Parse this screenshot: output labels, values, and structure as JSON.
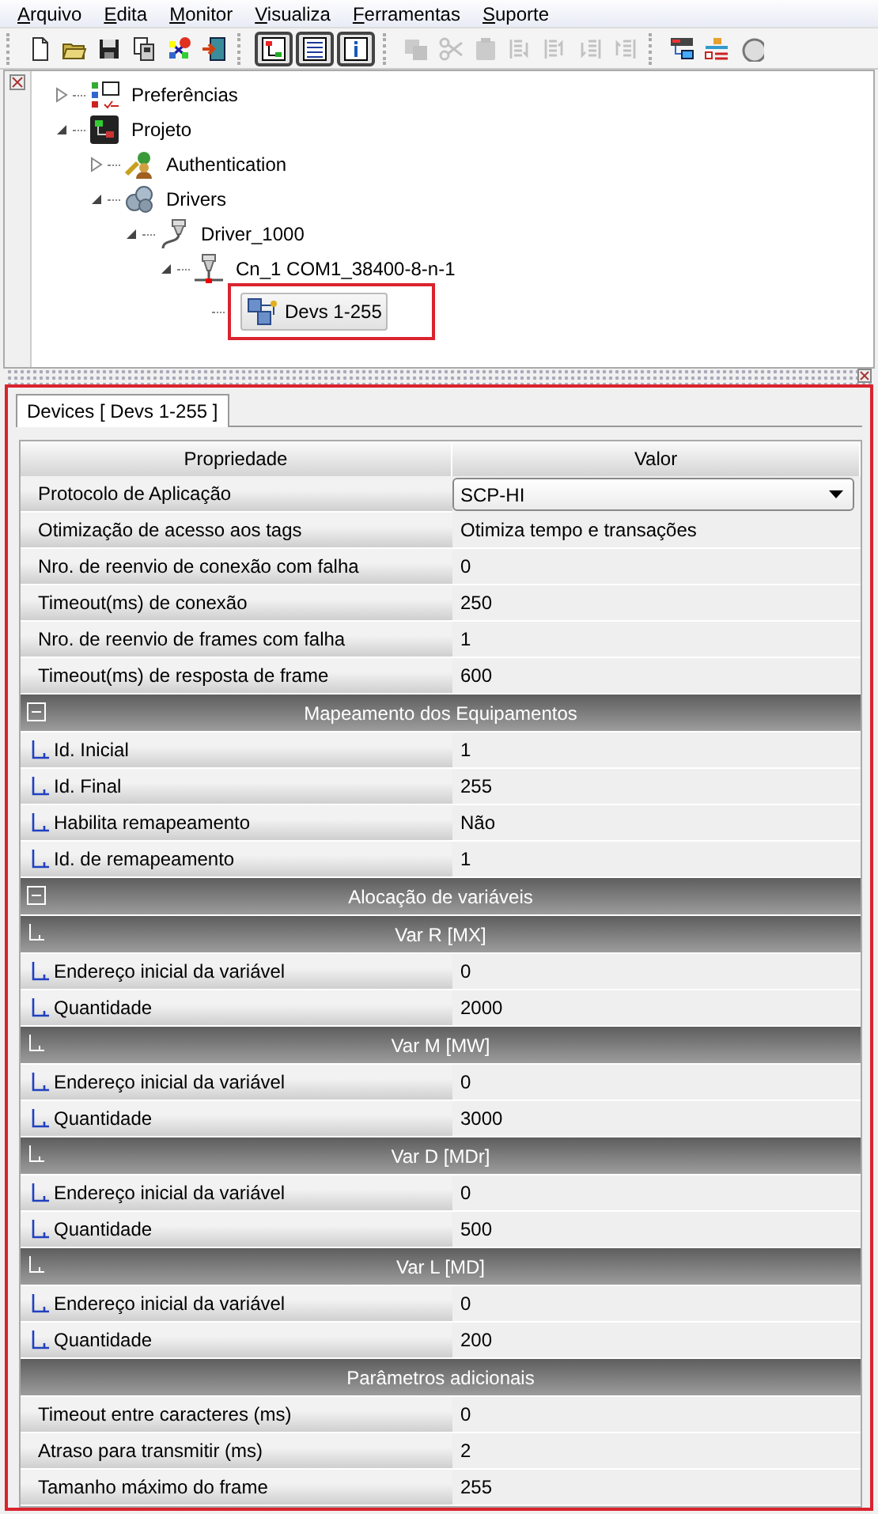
{
  "menu": [
    "Arquivo",
    "Edita",
    "Monitor",
    "Visualiza",
    "Ferramentas",
    "Suporte"
  ],
  "toolbar": [
    [
      {
        "disabled": false
      },
      {
        "disabled": false
      },
      {
        "disabled": false
      },
      {
        "disabled": false
      },
      {
        "disabled": false
      },
      {
        "disabled": false
      }
    ],
    [
      {
        "pressed": true
      },
      {
        "pressed": true
      },
      {
        "pressed": true
      }
    ],
    [
      {
        "disabled": true
      },
      {
        "disabled": true
      },
      {
        "disabled": true
      },
      {
        "disabled": true
      },
      {
        "disabled": true
      },
      {
        "disabled": true
      },
      {
        "disabled": true
      }
    ],
    [
      {
        "disabled": false
      },
      {
        "disabled": false
      },
      {
        "disabled": false
      }
    ]
  ],
  "tree": [
    {
      "label": "Preferências",
      "expanded": false,
      "selected": false
    },
    {
      "label": "Projeto",
      "expanded": true,
      "selected": false,
      "children": [
        {
          "label": "Authentication",
          "expanded": false,
          "selected": false
        },
        {
          "label": "Drivers",
          "expanded": true,
          "selected": false,
          "children": [
            {
              "label": "Driver_1000",
              "expanded": true,
              "selected": false,
              "children": [
                {
                  "label": "Cn_1 COM1_38400-8-n-1",
                  "expanded": true,
                  "selected": false,
                  "children": [
                    {
                      "label": "Devs 1-255",
                      "selected": true,
                      "highlighted": true
                    }
                  ]
                }
              ]
            }
          ]
        }
      ]
    }
  ],
  "panel": {
    "highlighted": true,
    "tab": {
      "label": "Devices [ Devs 1-255 ]",
      "selected": true
    },
    "columns": [
      "Propriedade",
      "Valor"
    ],
    "rows": [
      {
        "kind": "dropdown",
        "label": "Protocolo de Aplicação",
        "value": "SCP-HI"
      },
      {
        "kind": "property",
        "label": "Otimização de acesso aos tags",
        "value": "Otimiza tempo e transações"
      },
      {
        "kind": "property",
        "label": "Nro. de reenvio de conexão com falha",
        "value": "0"
      },
      {
        "kind": "property",
        "label": "Timeout(ms) de conexão",
        "value": "250"
      },
      {
        "kind": "property",
        "label": "Nro. de reenvio de frames com falha",
        "value": "1"
      },
      {
        "kind": "property",
        "label": "Timeout(ms) de resposta de frame",
        "value": "600"
      },
      {
        "kind": "section",
        "title": "Mapeamento dos Equipamentos",
        "collapsible": true
      },
      {
        "kind": "subproperty",
        "label": "Id. Inicial",
        "value": "1"
      },
      {
        "kind": "subproperty",
        "label": "Id. Final",
        "value": "255"
      },
      {
        "kind": "subproperty",
        "label": "Habilita remapeamento",
        "value": "Não"
      },
      {
        "kind": "subproperty",
        "label": "Id. de remapeamento",
        "value": "1"
      },
      {
        "kind": "section",
        "title": "Alocação de variáveis",
        "collapsible": true
      },
      {
        "kind": "subsection",
        "title": "Var R [MX]"
      },
      {
        "kind": "subproperty",
        "label": "Endereço inicial da variável",
        "value": "0"
      },
      {
        "kind": "subproperty",
        "label": "Quantidade",
        "value": "2000"
      },
      {
        "kind": "subsection",
        "title": "Var M [MW]"
      },
      {
        "kind": "subproperty",
        "label": "Endereço inicial da variável",
        "value": "0"
      },
      {
        "kind": "subproperty",
        "label": "Quantidade",
        "value": "3000"
      },
      {
        "kind": "subsection",
        "title": "Var D [MDr]"
      },
      {
        "kind": "subproperty",
        "label": "Endereço inicial da variável",
        "value": "0"
      },
      {
        "kind": "subproperty",
        "label": "Quantidade",
        "value": "500"
      },
      {
        "kind": "subsection",
        "title": "Var L [MD]"
      },
      {
        "kind": "subproperty",
        "label": "Endereço inicial da variável",
        "value": "0"
      },
      {
        "kind": "subproperty",
        "label": "Quantidade",
        "value": "200"
      },
      {
        "kind": "section",
        "title": "Parâmetros adicionais",
        "collapsible": false
      },
      {
        "kind": "property",
        "label": "Timeout entre caracteres (ms)",
        "value": "0"
      },
      {
        "kind": "property",
        "label": "Atraso para transmitir (ms)",
        "value": "2"
      },
      {
        "kind": "property",
        "label": "Tamanho máximo do frame",
        "value": "255"
      }
    ]
  }
}
